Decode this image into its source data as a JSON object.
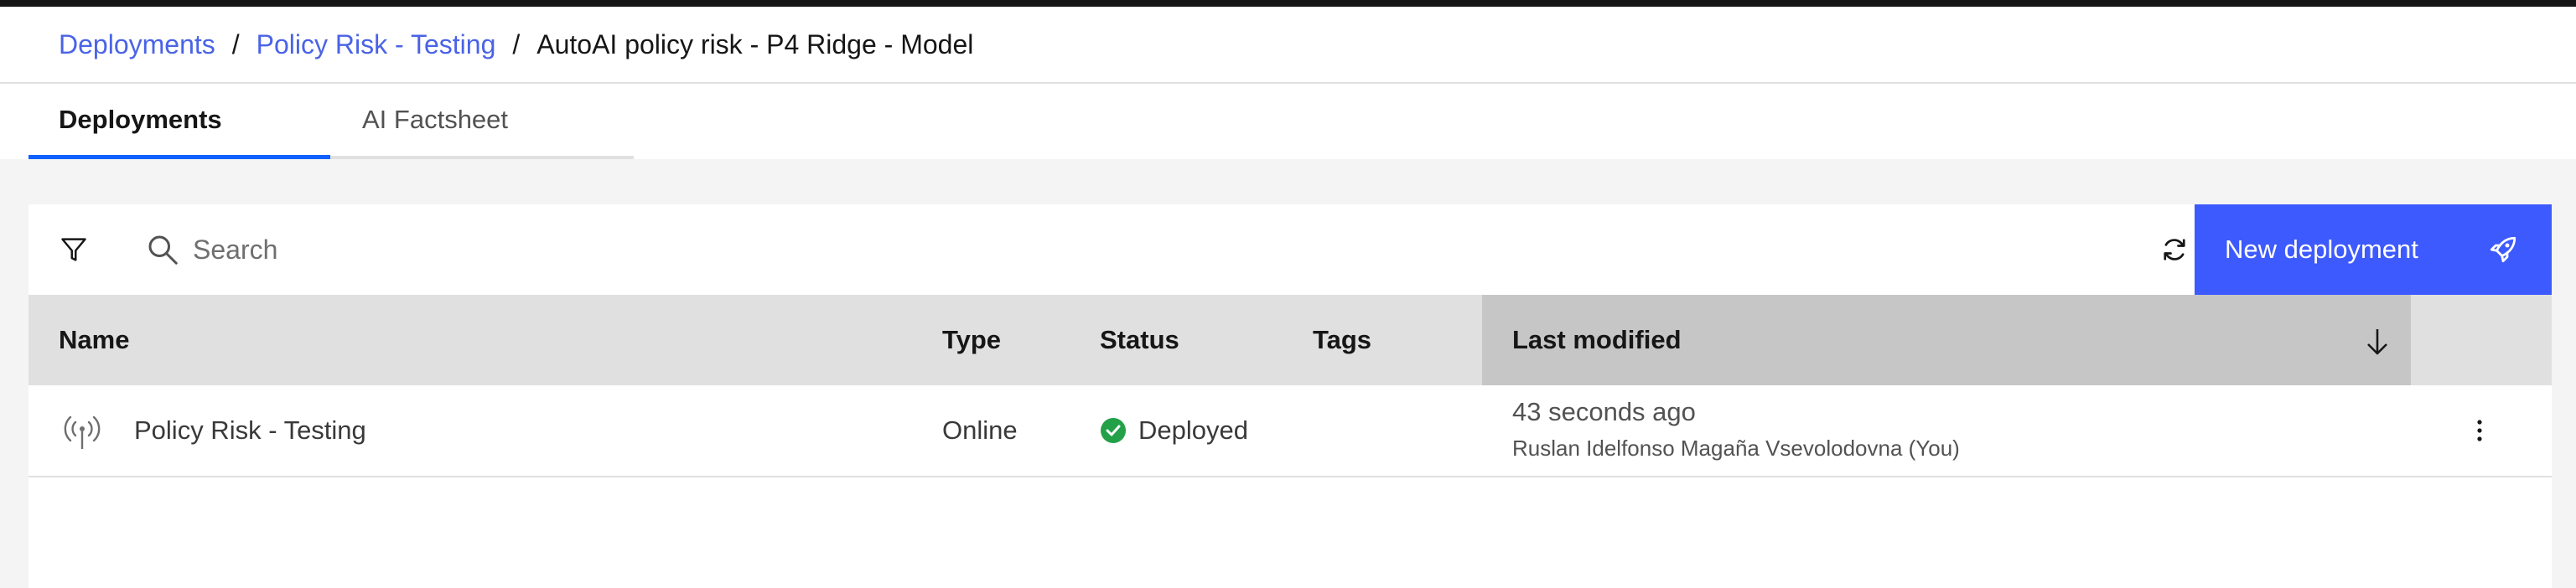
{
  "breadcrumb": {
    "items": [
      "Deployments",
      "Policy Risk - Testing"
    ],
    "separator": "/",
    "current": "AutoAI policy risk - P4 Ridge - Model"
  },
  "tabs": [
    {
      "label": "Deployments",
      "active": true
    },
    {
      "label": "AI Factsheet",
      "active": false
    }
  ],
  "toolbar": {
    "search_placeholder": "Search",
    "new_deployment_label": "New deployment",
    "icons": [
      "filter-icon",
      "search-icon",
      "refresh-icon",
      "rocket-icon"
    ]
  },
  "table": {
    "columns": [
      "Name",
      "Type",
      "Status",
      "Tags",
      "Last modified"
    ],
    "sort_column": "Last modified",
    "sort_direction": "descending",
    "rows": [
      {
        "name": "Policy Risk - Testing",
        "type": "Online",
        "status": "Deployed",
        "tags": "",
        "modified_time": "43 seconds ago",
        "modified_by": "Ruslan Idelfonso  Magaña Vsevolodovna (You)",
        "icon": "deployment-signal-icon"
      }
    ]
  },
  "colors": {
    "link": "#4a63e6",
    "primary_button": "#3d5afe",
    "status_success": "#42be65",
    "active_tab_underline": "#0f62fe"
  }
}
